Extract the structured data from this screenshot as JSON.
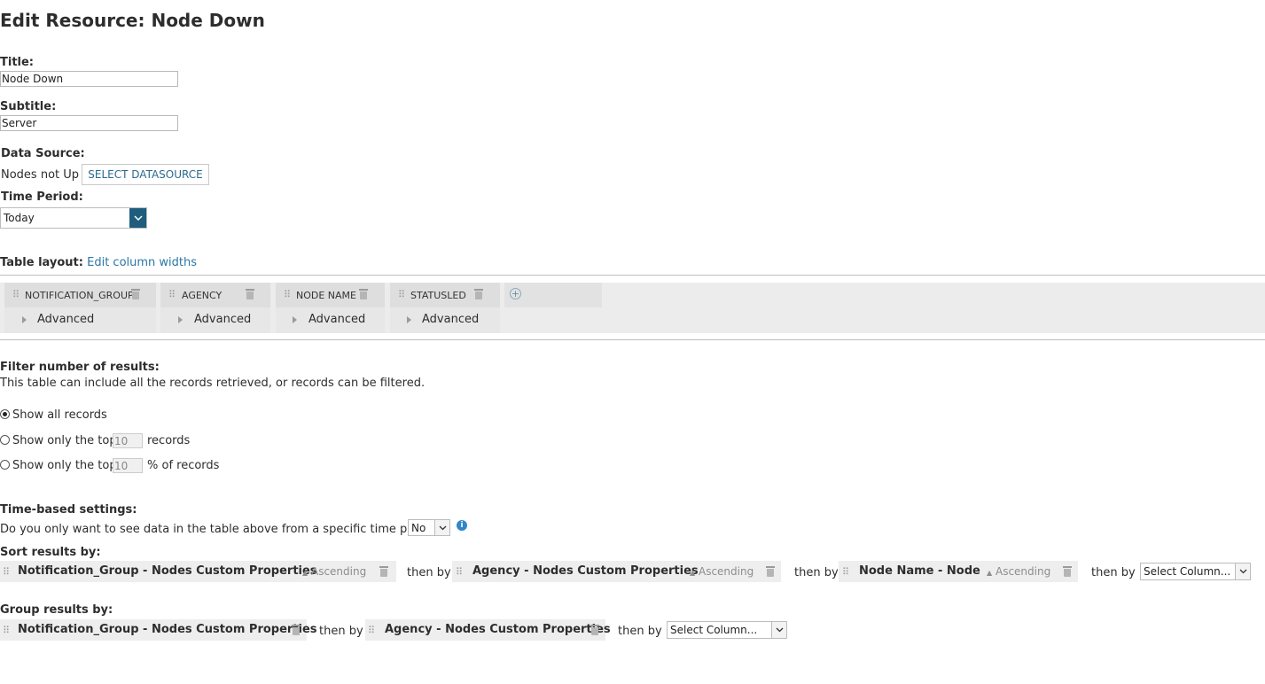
{
  "page_title": "Edit Resource: Node Down",
  "title_field": {
    "label": "Title:",
    "value": "Node Down"
  },
  "subtitle_field": {
    "label": "Subtitle:",
    "value": "Server"
  },
  "data_source": {
    "label": "Data Source:",
    "value": "Nodes not Up",
    "button": "SELECT DATASOURCE"
  },
  "time_period": {
    "label": "Time Period:",
    "selected": "Today"
  },
  "table_layout": {
    "label": "Table layout:",
    "edit_link": "Edit column widths",
    "columns": [
      {
        "name": "NOTIFICATION_GROUP",
        "advanced": "Advanced"
      },
      {
        "name": "AGENCY",
        "advanced": "Advanced"
      },
      {
        "name": "NODE NAME",
        "advanced": "Advanced"
      },
      {
        "name": "STATUSLED",
        "advanced": "Advanced"
      }
    ]
  },
  "filter": {
    "heading": "Filter number of results:",
    "description": "This table can include all the records retrieved, or records can be filtered.",
    "options": [
      {
        "label": "Show all records",
        "selected": true
      },
      {
        "prefix": "Show only the top",
        "value": "10",
        "suffix": "records",
        "selected": false
      },
      {
        "prefix": "Show only the top",
        "value": "10",
        "suffix": "% of records",
        "selected": false
      }
    ]
  },
  "time_based": {
    "heading": "Time-based settings:",
    "question": "Do you only want to see data in the table above from a specific time period?",
    "selected": "No"
  },
  "sort": {
    "heading": "Sort results by:",
    "then_by": "then by",
    "items": [
      {
        "column": "Notification_Group - Nodes Custom Properties",
        "direction": "Ascending"
      },
      {
        "column": "Agency - Nodes Custom Properties",
        "direction": "Ascending"
      },
      {
        "column": "Node Name - Node",
        "direction": "Ascending"
      }
    ],
    "select_placeholder": "Select Column..."
  },
  "group": {
    "heading": "Group results by:",
    "then_by": "then by",
    "items": [
      {
        "column": "Notification_Group - Nodes Custom Properties"
      },
      {
        "column": "Agency - Nodes Custom Properties"
      }
    ],
    "select_placeholder": "Select Column..."
  },
  "colors": {
    "accent": "#1f5d7d",
    "link": "#2b77a5",
    "info": "#2e88c9"
  }
}
